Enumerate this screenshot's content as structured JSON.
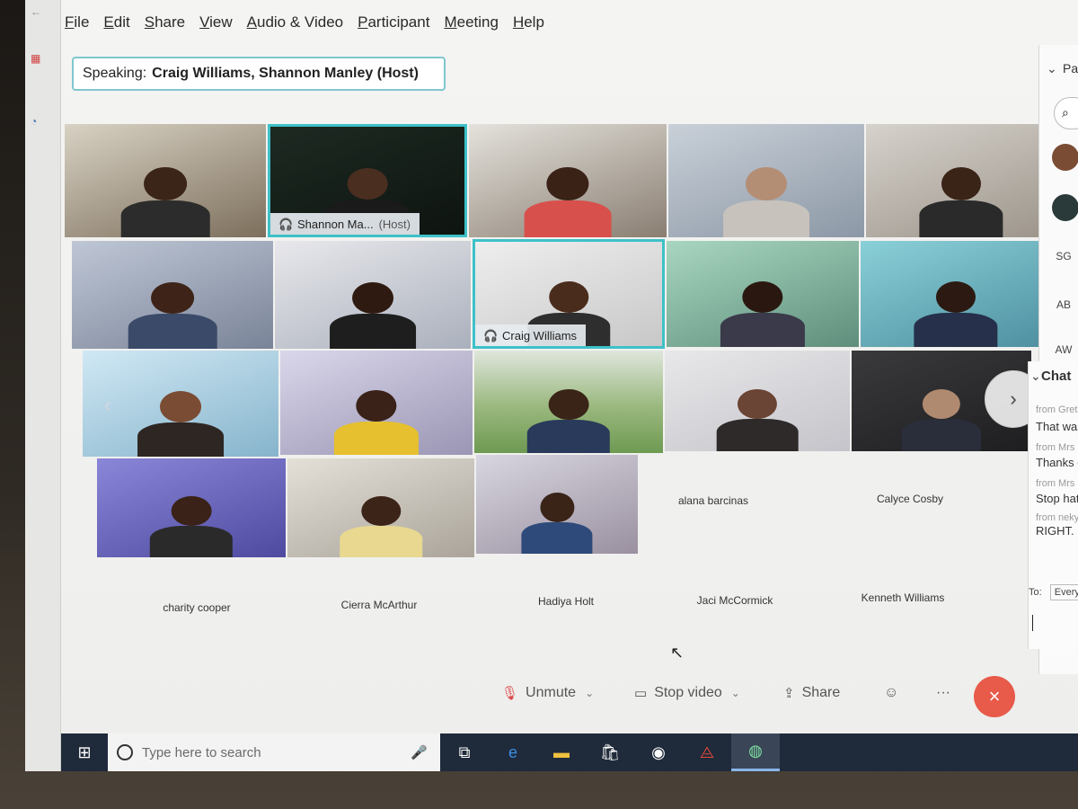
{
  "menu": [
    "File",
    "Edit",
    "Share",
    "View",
    "Audio & Video",
    "Participant",
    "Meeting",
    "Help"
  ],
  "speaking": {
    "label": "Speaking:",
    "names": "Craig Williams, Shannon Manley (Host)"
  },
  "tiles": {
    "shannon": {
      "name": "Shannon Ma...",
      "host": "(Host)"
    },
    "craig": {
      "name": "Craig Williams"
    }
  },
  "no_video_names": {
    "alana": "alana barcinas",
    "calyce": "Calyce Cosby",
    "charity": "charity cooper",
    "cierra": "Cierra McArthur",
    "hadiya": "Hadiya Holt",
    "jaci": "Jaci McCormick",
    "kenneth": "Kenneth Williams"
  },
  "participants_panel": {
    "title": "Pa",
    "avatars": [
      "SG",
      "AB",
      "AW"
    ]
  },
  "chat": {
    "title": "Chat",
    "messages": [
      {
        "from": "from Gretch",
        "text": "That was fu"
      },
      {
        "from": "from Mrs Del",
        "text": "Thanks got"
      },
      {
        "from": "from Mrs Del",
        "text": "Stop hating"
      },
      {
        "from": "from nekya br",
        "text": "RIGHT."
      }
    ],
    "to_label": "To:",
    "to_value": "Everyone"
  },
  "toolbar": {
    "unmute": "Unmute",
    "stop_video": "Stop video",
    "share": "Share"
  },
  "taskbar": {
    "search_placeholder": "Type here to search"
  },
  "colors": {
    "active_speaker": "#3ec0c8",
    "leave_button": "#e85a4a",
    "taskbar": "#1f2a3a"
  }
}
